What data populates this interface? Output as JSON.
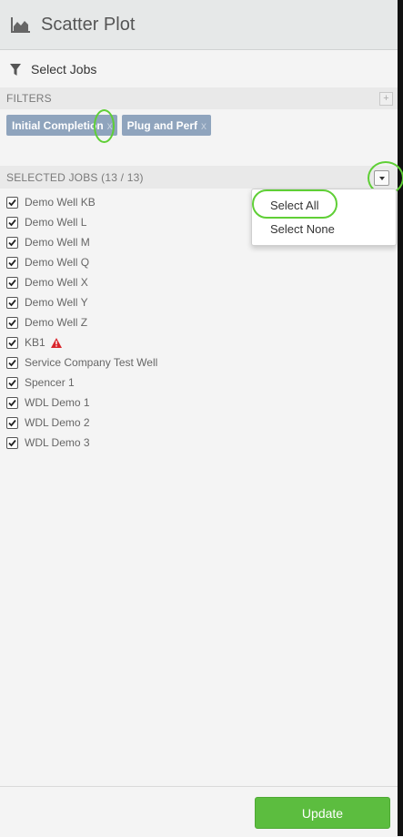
{
  "header": {
    "title": "Scatter Plot",
    "icon": "area-chart-icon"
  },
  "select_jobs": {
    "label": "Select Jobs",
    "icon": "filter-icon"
  },
  "filters": {
    "heading": "FILTERS",
    "add_label": "+",
    "chips": [
      {
        "label": "Initial Completion",
        "remove": "x"
      },
      {
        "label": "Plug and Perf",
        "remove": "x"
      }
    ]
  },
  "selected_jobs": {
    "heading": "SELECTED JOBS (13 / 13)",
    "jobs": [
      {
        "name": "Demo Well KB",
        "checked": true
      },
      {
        "name": "Demo Well L",
        "checked": true
      },
      {
        "name": "Demo Well M",
        "checked": true
      },
      {
        "name": "Demo Well Q",
        "checked": true
      },
      {
        "name": "Demo Well X",
        "checked": true
      },
      {
        "name": "Demo Well Y",
        "checked": true
      },
      {
        "name": "Demo Well Z",
        "checked": true
      },
      {
        "name": "KB1",
        "checked": true,
        "warning": true
      },
      {
        "name": "Service Company Test Well",
        "checked": true
      },
      {
        "name": "Spencer 1",
        "checked": true
      },
      {
        "name": "WDL Demo 1",
        "checked": true
      },
      {
        "name": "WDL Demo 2",
        "checked": true
      },
      {
        "name": "WDL Demo 3",
        "checked": true
      }
    ]
  },
  "dropdown": {
    "select_all": "Select All",
    "select_none": "Select None"
  },
  "footer": {
    "update_label": "Update"
  },
  "colors": {
    "accent_green": "#5cbd3f",
    "chip_blue": "#8fa4bd",
    "warning_red": "#d9262c",
    "highlight_ring": "#5fcf36"
  }
}
